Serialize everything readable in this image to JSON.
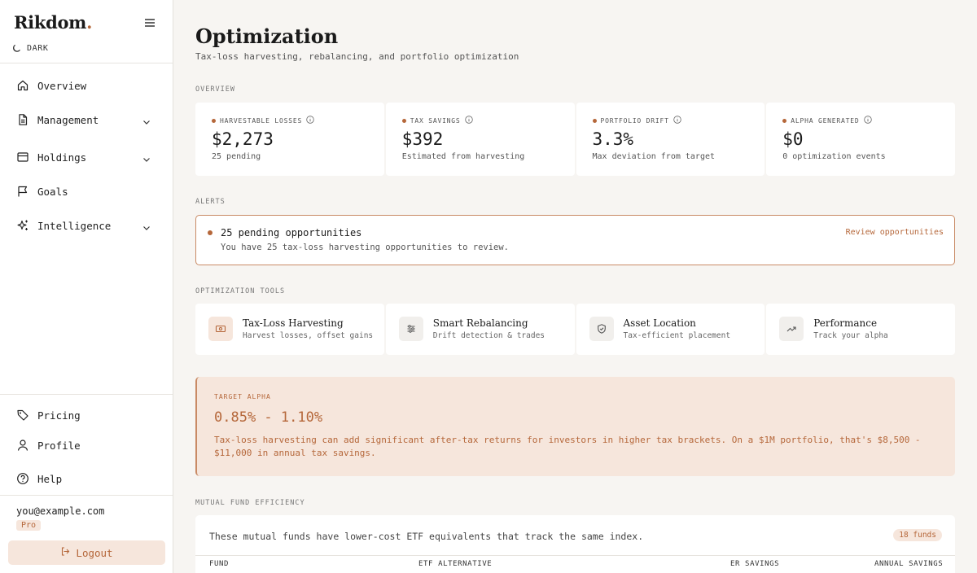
{
  "sidebar": {
    "brand": "Rikdom",
    "brand_dot": ".",
    "theme_label": "DARK",
    "nav": [
      {
        "label": "Overview"
      },
      {
        "label": "Management"
      },
      {
        "label": "Holdings"
      },
      {
        "label": "Goals"
      },
      {
        "label": "Intelligence"
      }
    ],
    "bottom_nav": [
      {
        "label": "Pricing"
      },
      {
        "label": "Profile"
      },
      {
        "label": "Help"
      }
    ],
    "user_email": "you@example.com",
    "plan_badge": "Pro",
    "logout_label": "Logout"
  },
  "page": {
    "title": "Optimization",
    "subtitle": "Tax-loss harvesting, rebalancing, and portfolio optimization"
  },
  "overview": {
    "section_label": "OVERVIEW",
    "stats": [
      {
        "label": "HARVESTABLE LOSSES",
        "value": "$2,273",
        "note": "25 pending"
      },
      {
        "label": "TAX SAVINGS",
        "value": "$392",
        "note": "Estimated from harvesting"
      },
      {
        "label": "PORTFOLIO DRIFT",
        "value": "3.3%",
        "note": "Max deviation from target"
      },
      {
        "label": "ALPHA GENERATED",
        "value": "$0",
        "note": "0 optimization events"
      }
    ]
  },
  "alerts": {
    "section_label": "ALERTS",
    "title": "25 pending opportunities",
    "message": "You have 25 tax-loss harvesting opportunities to review.",
    "action": "Review opportunities"
  },
  "tools": {
    "section_label": "OPTIMIZATION TOOLS",
    "items": [
      {
        "name": "Tax-Loss Harvesting",
        "desc": "Harvest losses, offset gains",
        "icon": "money-icon"
      },
      {
        "name": "Smart Rebalancing",
        "desc": "Drift detection & trades",
        "icon": "sliders-icon"
      },
      {
        "name": "Asset Location",
        "desc": "Tax-efficient placement",
        "icon": "shield-icon"
      },
      {
        "name": "Performance",
        "desc": "Track your alpha",
        "icon": "trending-up-icon"
      }
    ]
  },
  "target_alpha": {
    "label": "TARGET ALPHA",
    "value": "0.85% - 1.10%",
    "text": "Tax-loss harvesting can add significant after-tax returns for investors in higher tax brackets. On a $1M portfolio, that's $8,500 - $11,000 in annual tax savings."
  },
  "funds": {
    "section_label": "MUTUAL FUND EFFICIENCY",
    "intro": "These mutual funds have lower-cost ETF equivalents that track the same index.",
    "count": "18 funds",
    "columns": [
      "FUND",
      "ETF ALTERNATIVE",
      "ER SAVINGS",
      "ANNUAL SAVINGS"
    ]
  },
  "colors": {
    "accent": "#b5673a",
    "accent_soft": "#f6e6dc",
    "background": "#f7f5f2"
  }
}
